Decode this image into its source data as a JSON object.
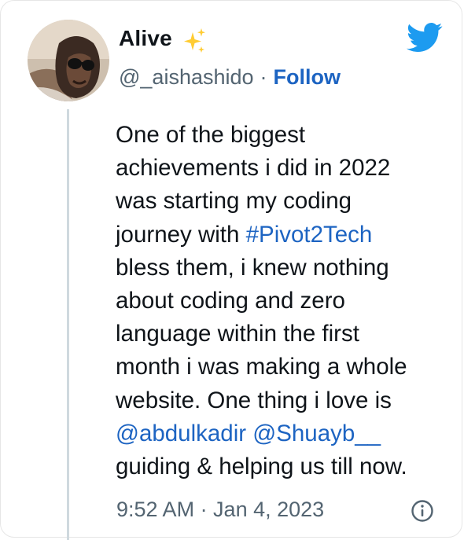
{
  "author": {
    "display_name": "Alive",
    "handle": "@_aishashido",
    "separator": "·",
    "follow_label": "Follow"
  },
  "tweet": {
    "line1": "One of the biggest",
    "line2": "achievements i did in 2022",
    "line3": "was starting my coding",
    "line4_prefix": "journey with ",
    "hashtag": "#Pivot2Tech",
    "line5": "bless them, i knew nothing",
    "line6": "about coding and zero",
    "line7": "language within the first",
    "line8": "month i was making a whole",
    "line9": "website. One thing i love is",
    "mention1": "@abdulkadir",
    "mention2": "@Shuayb__",
    "line11": "guiding & helping us till now."
  },
  "meta": {
    "timestamp": "9:52 AM · Jan 4, 2023"
  },
  "icons": {
    "sparkles": "sparkles-emoji-icon",
    "twitter": "twitter-bird-icon",
    "info": "info-icon"
  },
  "colors": {
    "link": "#1d64c2",
    "twitter_blue": "#1d9bf0",
    "muted_text": "#536471",
    "sparkle_yellow": "#ffcc33",
    "thread_line": "#cfd9de"
  }
}
